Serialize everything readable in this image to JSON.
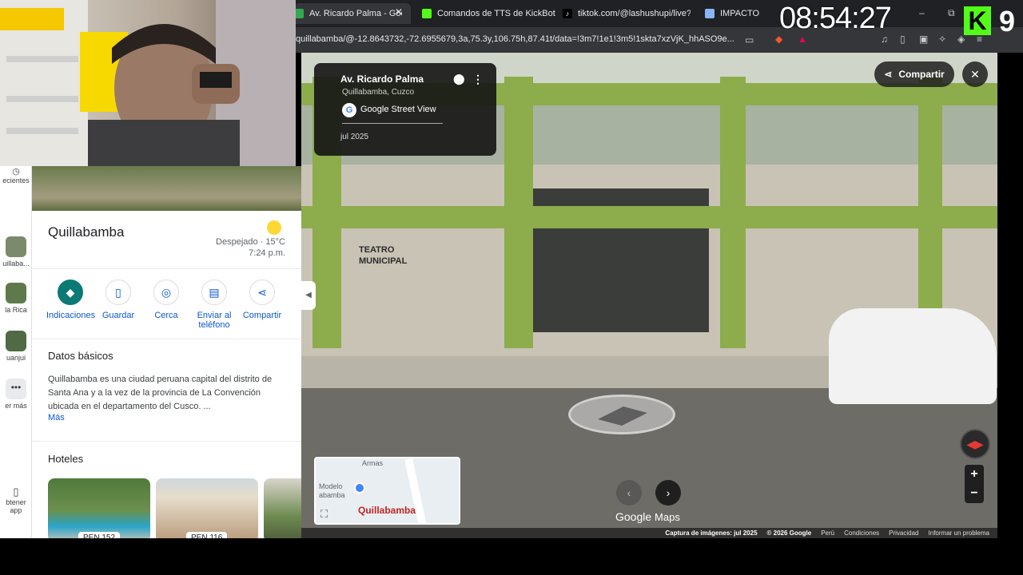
{
  "browser": {
    "tabs": [
      {
        "label": "Av. Ricardo Palma - Googl",
        "active": true,
        "favicon_color": "#34a853"
      },
      {
        "label": "Comandos de TTS de KickBot",
        "active": false,
        "favicon_color": "#53fc18"
      },
      {
        "label": "tiktok.com/@lashushupi/live?e",
        "active": false,
        "favicon_color": "#ffffff"
      },
      {
        "label": "IMPACTO",
        "active": false,
        "favicon_color": "#8ab4f8"
      }
    ],
    "url": "quillabamba/@-12.8643732,-72.6955679,3a,75.3y,106.75h,87.41t/data=!3m7!1e1!3m5!1skta7xzVjK_hhASO9e...",
    "minimize": "–",
    "restore": "⧉",
    "tab_close": "✕"
  },
  "overlay": {
    "clock": "08:54:27",
    "kick_logo": "K",
    "kick_number": "9",
    "kick_color": "#53fc18"
  },
  "rail": {
    "items": [
      {
        "label": "ecientes"
      },
      {
        "label": "uillaba..."
      },
      {
        "label": "la Rica"
      },
      {
        "label": "uanjui"
      },
      {
        "label": "er más"
      },
      {
        "label": "btener app"
      }
    ]
  },
  "panel": {
    "place_name": "Quillabamba",
    "weather": "Despejado · 15°C",
    "weather_time": "7:24 p.m.",
    "actions": [
      {
        "label": "Indicaciones",
        "icon": "directions-icon"
      },
      {
        "label": "Guardar",
        "icon": "bookmark-icon"
      },
      {
        "label": "Cerca",
        "icon": "nearby-icon"
      },
      {
        "label": "Enviar al teléfono",
        "icon": "send-to-phone-icon"
      },
      {
        "label": "Compartir",
        "icon": "share-icon"
      }
    ],
    "basics_title": "Datos básicos",
    "basics_text": "Quillabamba es una ciudad peruana capital del distrito de Santa Ana y a la vez de la provincia de La Convención ubicada en el departamento del Cusco. ...",
    "more_link": "Más",
    "hotels_title": "Hoteles",
    "hotels": [
      {
        "price": "PEN 152"
      },
      {
        "price": "PEN 116"
      },
      {
        "price": ""
      }
    ]
  },
  "streetview": {
    "info_title": "Av. Ricardo Palma",
    "info_subtitle": "Quillabamba, Cuzco",
    "info_source": "Google Street View",
    "info_date": "jul 2025",
    "share_label": "Compartir",
    "building_sign": "TEATRO MUNICIPAL",
    "minimap": {
      "label_top": "Armas",
      "label_left": "Modelo abamba",
      "city": "Quillabamba"
    },
    "logo_google": "Google",
    "logo_maps": "Maps",
    "footer": {
      "capture": "Captura de imágenes: jul 2025",
      "copyright": "© 2026 Google",
      "country": "Perú",
      "terms": "Condiciones",
      "privacy": "Privacidad",
      "report": "Informar un problema"
    }
  }
}
